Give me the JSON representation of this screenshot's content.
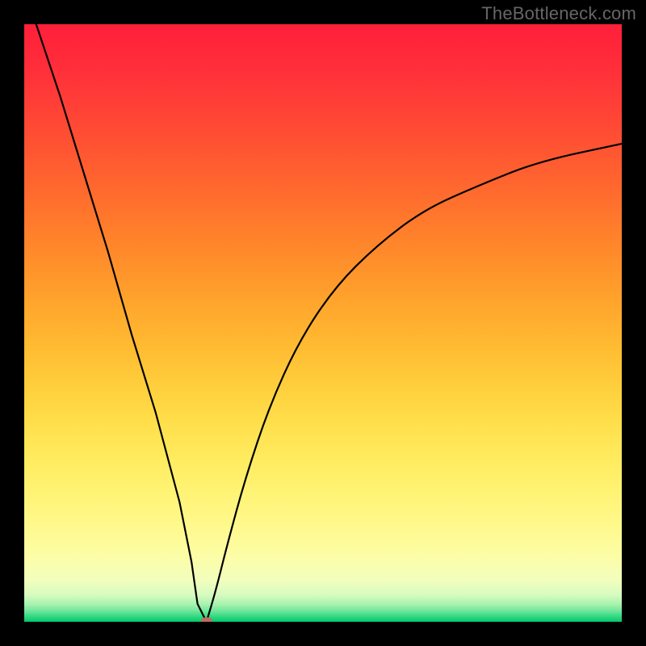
{
  "watermark": "TheBottleneck.com",
  "chart_data": {
    "type": "line",
    "title": "",
    "xlabel": "",
    "ylabel": "",
    "xlim": [
      0,
      100
    ],
    "ylim": [
      0,
      100
    ],
    "grid": false,
    "legend": false,
    "min_point": {
      "x": 30.5,
      "y": 0
    },
    "min_marker_color": "#c36a5e",
    "line_color": "#000000",
    "series": [
      {
        "name": "left-branch",
        "x": [
          2,
          6,
          10,
          14,
          18,
          22,
          26,
          28,
          29,
          30.5
        ],
        "y": [
          100,
          88,
          75,
          62,
          48,
          35,
          20,
          10,
          3,
          0
        ]
      },
      {
        "name": "right-branch",
        "x": [
          30.5,
          32,
          34,
          37,
          41,
          46,
          52,
          59,
          67,
          76,
          86,
          100
        ],
        "y": [
          0,
          5,
          13,
          24,
          36,
          47,
          56,
          63,
          69,
          73,
          77,
          80
        ]
      }
    ],
    "background_gradient": {
      "orientation": "vertical",
      "stops": [
        {
          "pos": 0.0,
          "color": "#ff1f3a"
        },
        {
          "pos": 0.5,
          "color": "#ffb030"
        },
        {
          "pos": 0.8,
          "color": "#fff373"
        },
        {
          "pos": 0.95,
          "color": "#d7fbc0"
        },
        {
          "pos": 1.0,
          "color": "#00c96a"
        }
      ]
    }
  }
}
